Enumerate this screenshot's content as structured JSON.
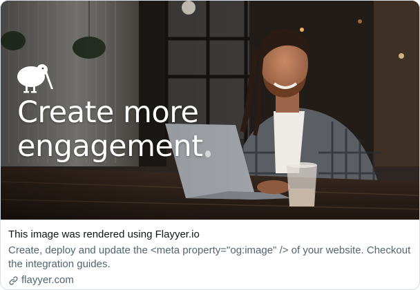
{
  "card": {
    "hero": {
      "headline": "Create more engagement",
      "logo_icon": "kiwi-bird-logo"
    },
    "preview": {
      "title": "This image was rendered using Flayyer.io",
      "description": "Create, deploy and update the <meta property=\"og:image\" /> of your website. Checkout the integration guides.",
      "domain": "flayyer.com",
      "domain_icon": "link-icon"
    }
  },
  "colors": {
    "title_text": "#0f1419",
    "secondary_text": "#536471",
    "card_border": "#d9dfe5",
    "headline_text": "#ffffff"
  }
}
